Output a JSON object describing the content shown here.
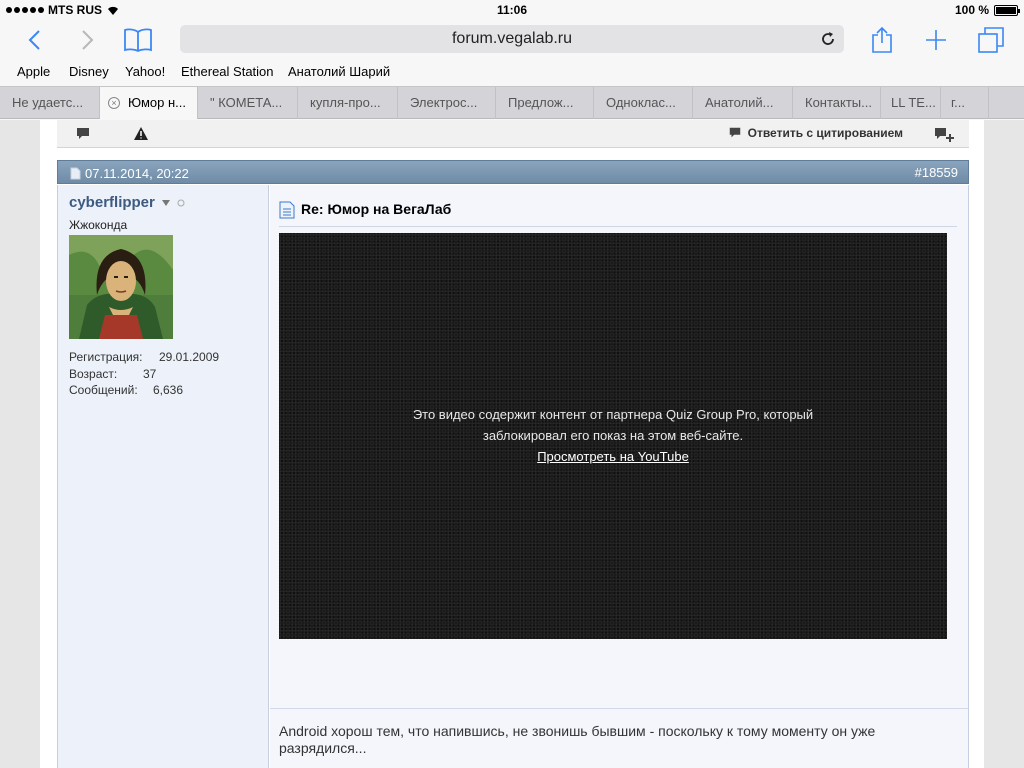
{
  "status_bar": {
    "carrier": "MTS RUS",
    "time": "11:06",
    "battery": "100 %",
    "battery_level": 1.0
  },
  "nav": {
    "url": "forum.vegalab.ru"
  },
  "bookmarks": [
    "Apple",
    "Disney",
    "Yahoo!",
    "Ethereal Station",
    "Анатолий Шарий"
  ],
  "tabs": [
    {
      "label": "Не удаетс..."
    },
    {
      "label": "Юмор н...",
      "active": true
    },
    {
      "label": "\" КОМЕТА..."
    },
    {
      "label": "купля-про..."
    },
    {
      "label": "Электрос..."
    },
    {
      "label": "Предлож..."
    },
    {
      "label": "Одноклас..."
    },
    {
      "label": "Анатолий..."
    },
    {
      "label": "Контакты..."
    },
    {
      "label": "LL TE..."
    },
    {
      "label": "г..."
    }
  ],
  "toolbar": {
    "reply_quote": "Ответить с цитированием"
  },
  "post": {
    "date": "07.11.2014, 20:22",
    "number": "#18559",
    "title": "Re: Юмор на ВегаЛаб",
    "video_message_line1": "Это видео содержит контент от партнера Quiz Group Pro, который",
    "video_message_line2": "заблокировал его показ на этом веб-сайте.",
    "video_link": "Просмотреть на YouTube",
    "signature": "Android хорош тем, что напившись, не звонишь бывшим - поскольку к тому моменту он уже разрядился..."
  },
  "user": {
    "name": "cyberflipper",
    "title": "Жжоконда",
    "reg_label": "Регистрация:",
    "reg_value": "29.01.2009",
    "age_label": "Возраст:",
    "age_value": "37",
    "posts_label": "Сообщений:",
    "posts_value": "6,636"
  },
  "colors": {
    "accent": "#3b88f5",
    "post_header": "#7a95ae",
    "username": "#3d5a80"
  }
}
